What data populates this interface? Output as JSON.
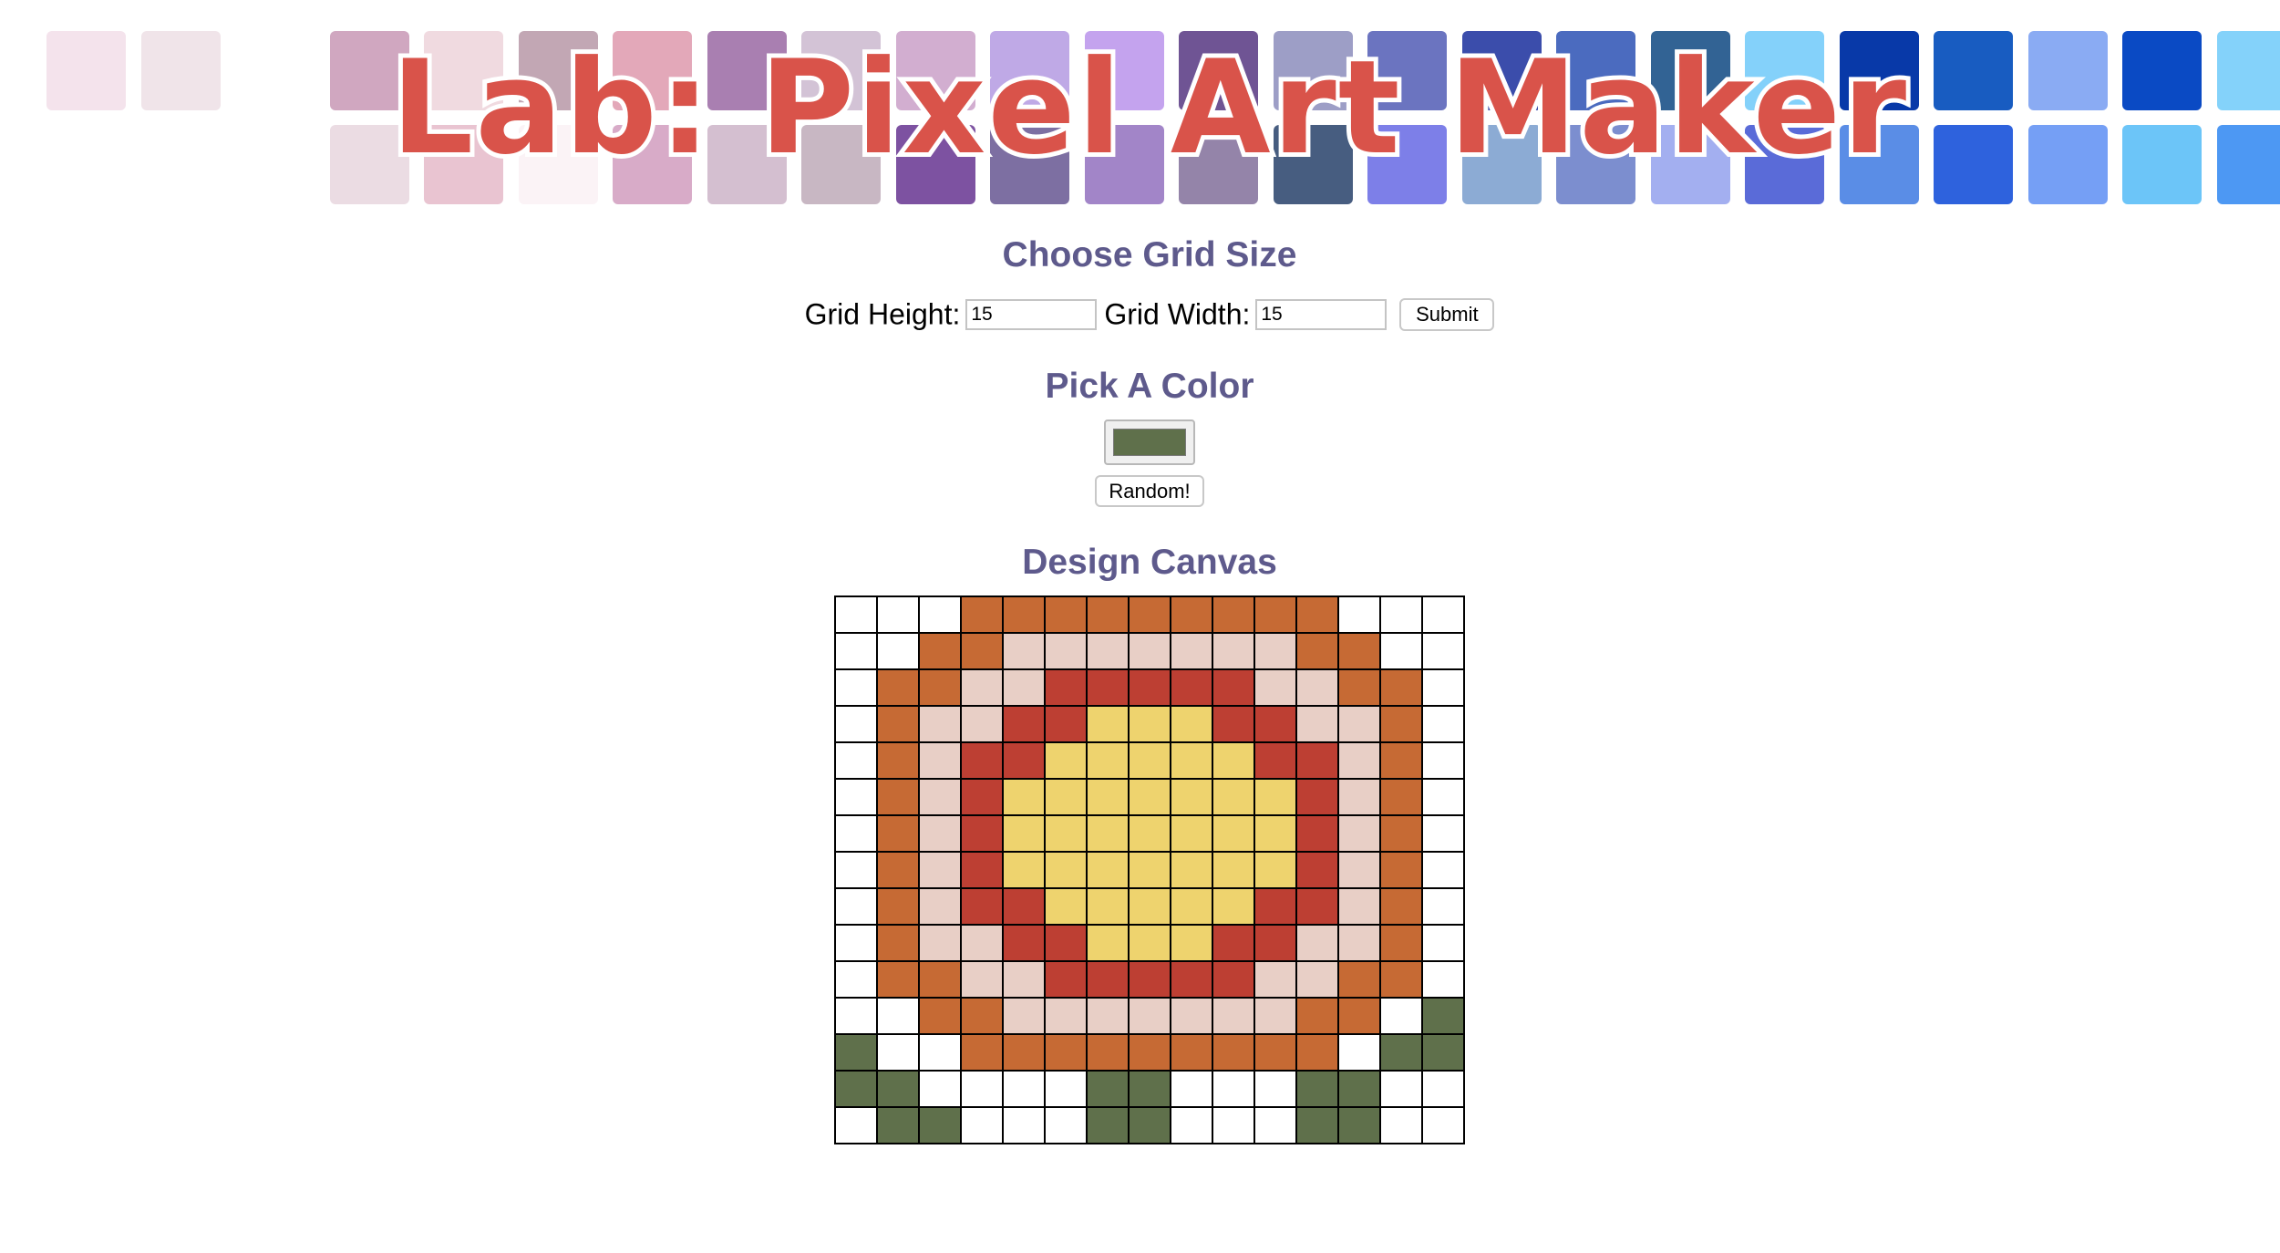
{
  "page": {
    "title": "Lab: Pixel Art Maker"
  },
  "banner_swatch_colors": [
    [
      "#f4e3ec",
      "#f0e4e9",
      null,
      "#d0a7c0",
      "#f0dae0",
      "#c2a7b4",
      "#e3a8b9",
      "#a97fb1",
      "#d3c3d6",
      "#d2aed0",
      "#bfa9e6",
      "#c4a3ee",
      "#6f5494",
      "#9d9ec6",
      "#6b74c0",
      "#3b4dab",
      "#4b6bbf",
      "#326394",
      "#84d1fa",
      "#0839a8",
      "#185cc1",
      "#8aabf3",
      "#0a4ac4",
      "#84d2fa"
    ],
    [
      null,
      null,
      null,
      "#ebdce3",
      "#e9c4d1",
      "#fbf3f6",
      "#d8abc8",
      "#d4bfd0",
      "#c8b7c3",
      "#7d52a1",
      "#7d6fa2",
      "#a285c8",
      "#9484a9",
      "#475d80",
      "#7d7fe8",
      "#8cabd4",
      "#7c8ecf",
      "#a3aff0",
      "#5a6bd8",
      "#5a8de6",
      "#2e62dd",
      "#759ff5",
      "#6cc5f8",
      "#4d98f3"
    ]
  ],
  "size_form": {
    "heading": "Choose Grid Size",
    "height_label": "Grid Height:",
    "height_value": "15",
    "width_label": "Grid Width:",
    "width_value": "15",
    "submit_label": "Submit"
  },
  "color_section": {
    "heading": "Pick A Color",
    "selected_color": "#5f704b",
    "random_label": "Random!"
  },
  "canvas": {
    "heading": "Design Canvas",
    "palette": {
      "W": "#ffffff",
      "O": "#c66a34",
      "P": "#e8cfc6",
      "R": "#bd3f33",
      "Y": "#eed36e",
      "G": "#5f704b"
    },
    "rows": [
      "WWWOOOOOOOOOWWW",
      "WWOOPPPPPPPOOWW",
      "WOOPPRRRRRPPOOW",
      "WOPPRRYYYRRPPOW",
      "WOPRRYYYYYRRPOW",
      "WOPRYYYYYYYRPOW",
      "WOPRYYYYYYYRPOW",
      "WOPRYYYYYYYRPOW",
      "WOPRRYYYYYRRPOW",
      "WOPPRRYYYRRPPOW",
      "WOOPPRRRRRPPOOW",
      "WWOOPPPPPPPOOWG",
      "GWWOOOOOOOOOWGG",
      "GGWWWWGGWWWGGWW",
      "WGGWWWGGWWWGGWW"
    ]
  }
}
